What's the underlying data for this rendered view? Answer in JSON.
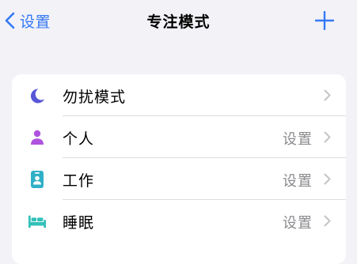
{
  "nav": {
    "back_label": "设置",
    "title": "专注模式",
    "add_icon": "plus-icon",
    "back_icon": "chevron-left-icon"
  },
  "colors": {
    "accent": "#3478f6",
    "moon": "#5856d6",
    "person": "#af52de",
    "badge": "#30b0c7",
    "bed": "#34c0b8",
    "background": "#f2f2f7"
  },
  "focus_modes": [
    {
      "label": "勿扰模式",
      "status": "",
      "icon": "moon-icon"
    },
    {
      "label": "个人",
      "status": "设置",
      "icon": "person-icon"
    },
    {
      "label": "工作",
      "status": "设置",
      "icon": "id-badge-icon"
    },
    {
      "label": "睡眠",
      "status": "设置",
      "icon": "bed-icon"
    }
  ]
}
